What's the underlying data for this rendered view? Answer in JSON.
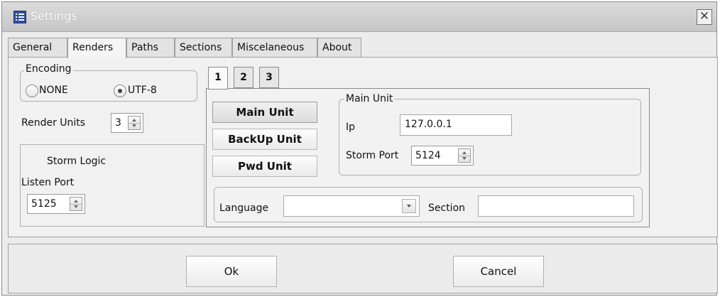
{
  "window": {
    "title": "Settings",
    "close_glyph": "✕"
  },
  "tabs": [
    {
      "label": "General"
    },
    {
      "label": "Renders"
    },
    {
      "label": "Paths"
    },
    {
      "label": "Sections"
    },
    {
      "label": "Miscelaneous"
    },
    {
      "label": "About"
    }
  ],
  "active_tab": "Renders",
  "encoding": {
    "label": "Encoding",
    "options": [
      "NONE",
      "UTF-8"
    ],
    "selected": "UTF-8"
  },
  "render_units": {
    "label": "Render Units",
    "value": "3"
  },
  "storm_logic": {
    "title": "Storm Logic",
    "listen_port_label": "Listen Port",
    "listen_port_value": "5125"
  },
  "subtabs": [
    "1",
    "2",
    "3"
  ],
  "active_subtab": "1",
  "unit_buttons": [
    "Main Unit",
    "BackUp Unit",
    "Pwd Unit"
  ],
  "active_unit": "Main Unit",
  "main_unit": {
    "group_label": "Main Unit",
    "ip_label": "Ip",
    "ip_value": "127.0.0.1",
    "storm_port_label": "Storm Port",
    "storm_port_value": "5124"
  },
  "language": {
    "label": "Language",
    "value": ""
  },
  "section": {
    "label": "Section",
    "value": ""
  },
  "footer": {
    "ok_label": "Ok",
    "cancel_label": "Cancel"
  },
  "icons": {
    "app": "settings-list-icon",
    "close": "close-icon",
    "spin": "spin-arrows-icon",
    "combo": "chevron-down-icon"
  }
}
